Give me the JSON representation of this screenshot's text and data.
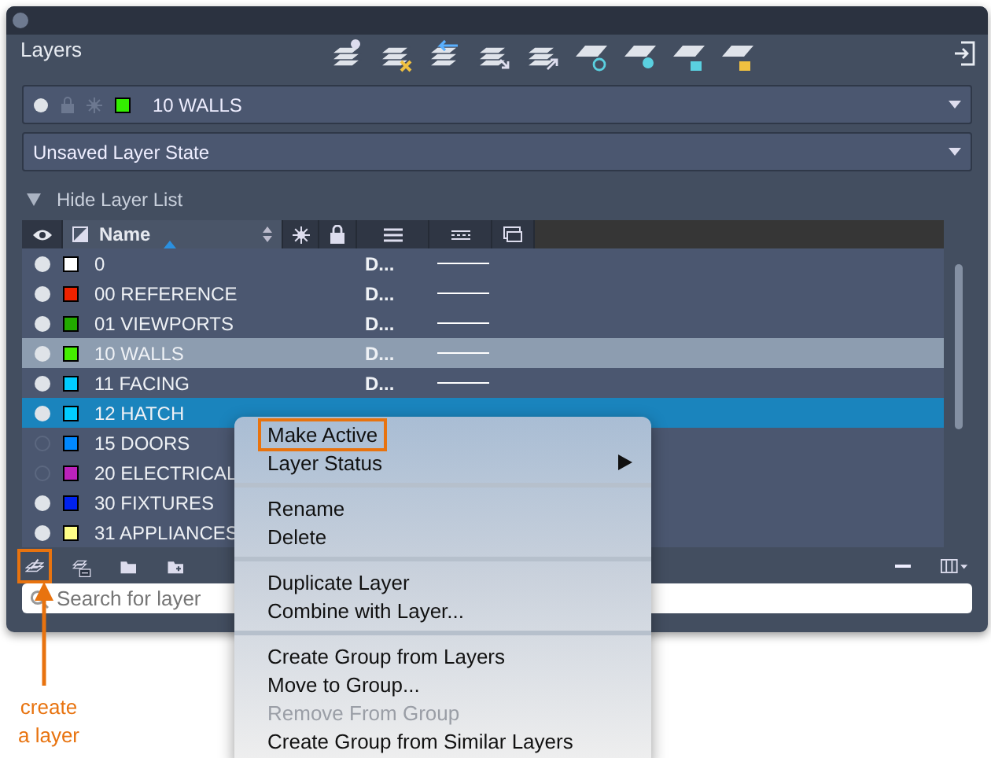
{
  "window": {
    "title": "Layers"
  },
  "current_layer": {
    "name": "10 WALLS",
    "color": "#33ee00"
  },
  "layer_state": {
    "value": "Unsaved Layer State"
  },
  "list_toggle": {
    "label": "Hide Layer List",
    "expanded": true
  },
  "table": {
    "name_heading": "Name",
    "rows": [
      {
        "name": "0",
        "color": "#ffffff",
        "on": true,
        "linetype": "D...",
        "selected": false,
        "current": false
      },
      {
        "name": "00 REFERENCE",
        "color": "#ee2200",
        "on": true,
        "linetype": "D...",
        "selected": false,
        "current": false
      },
      {
        "name": "01 VIEWPORTS",
        "color": "#22aa00",
        "on": true,
        "linetype": "D...",
        "selected": false,
        "current": false
      },
      {
        "name": "10 WALLS",
        "color": "#44ee00",
        "on": true,
        "linetype": "D...",
        "selected": false,
        "current": true
      },
      {
        "name": "11 FACING",
        "color": "#00ccff",
        "on": true,
        "linetype": "D...",
        "selected": false,
        "current": false
      },
      {
        "name": "12 HATCH",
        "color": "#00ccff",
        "on": true,
        "selected": true,
        "current": false
      },
      {
        "name": "15 DOORS",
        "color": "#0088ff",
        "on": false,
        "selected": false,
        "current": false
      },
      {
        "name": "20 ELECTRICAL",
        "color": "#bb22bb",
        "on": false,
        "selected": false,
        "current": false
      },
      {
        "name": "30 FIXTURES",
        "color": "#0022ee",
        "on": true,
        "selected": false,
        "current": false
      },
      {
        "name": "31 APPLIANCES",
        "color": "#ffff88",
        "on": true,
        "selected": false,
        "current": false
      }
    ]
  },
  "search": {
    "placeholder": "Search for layer"
  },
  "context_menu": {
    "items": [
      {
        "kind": "item",
        "label": "Make Active",
        "disabled": false,
        "submenu": false,
        "highlighted": true
      },
      {
        "kind": "item",
        "label": "Layer Status",
        "disabled": false,
        "submenu": true,
        "highlighted": false
      },
      {
        "kind": "separator"
      },
      {
        "kind": "item",
        "label": "Rename",
        "disabled": false,
        "submenu": false,
        "highlighted": false
      },
      {
        "kind": "item",
        "label": "Delete",
        "disabled": false,
        "submenu": false,
        "highlighted": false
      },
      {
        "kind": "separator"
      },
      {
        "kind": "item",
        "label": "Duplicate Layer",
        "disabled": false,
        "submenu": false,
        "highlighted": false
      },
      {
        "kind": "item",
        "label": "Combine with Layer...",
        "disabled": false,
        "submenu": false,
        "highlighted": false
      },
      {
        "kind": "separator"
      },
      {
        "kind": "item",
        "label": "Create Group from Layers",
        "disabled": false,
        "submenu": false,
        "highlighted": false
      },
      {
        "kind": "item",
        "label": "Move to Group...",
        "disabled": false,
        "submenu": false,
        "highlighted": false
      },
      {
        "kind": "item",
        "label": "Remove From Group",
        "disabled": true,
        "submenu": false,
        "highlighted": false
      },
      {
        "kind": "item",
        "label": "Create Group from Similar Layers",
        "disabled": false,
        "submenu": false,
        "highlighted": false
      }
    ]
  },
  "annotation": {
    "label": "create a layer",
    "highlight_new_layer": true
  }
}
